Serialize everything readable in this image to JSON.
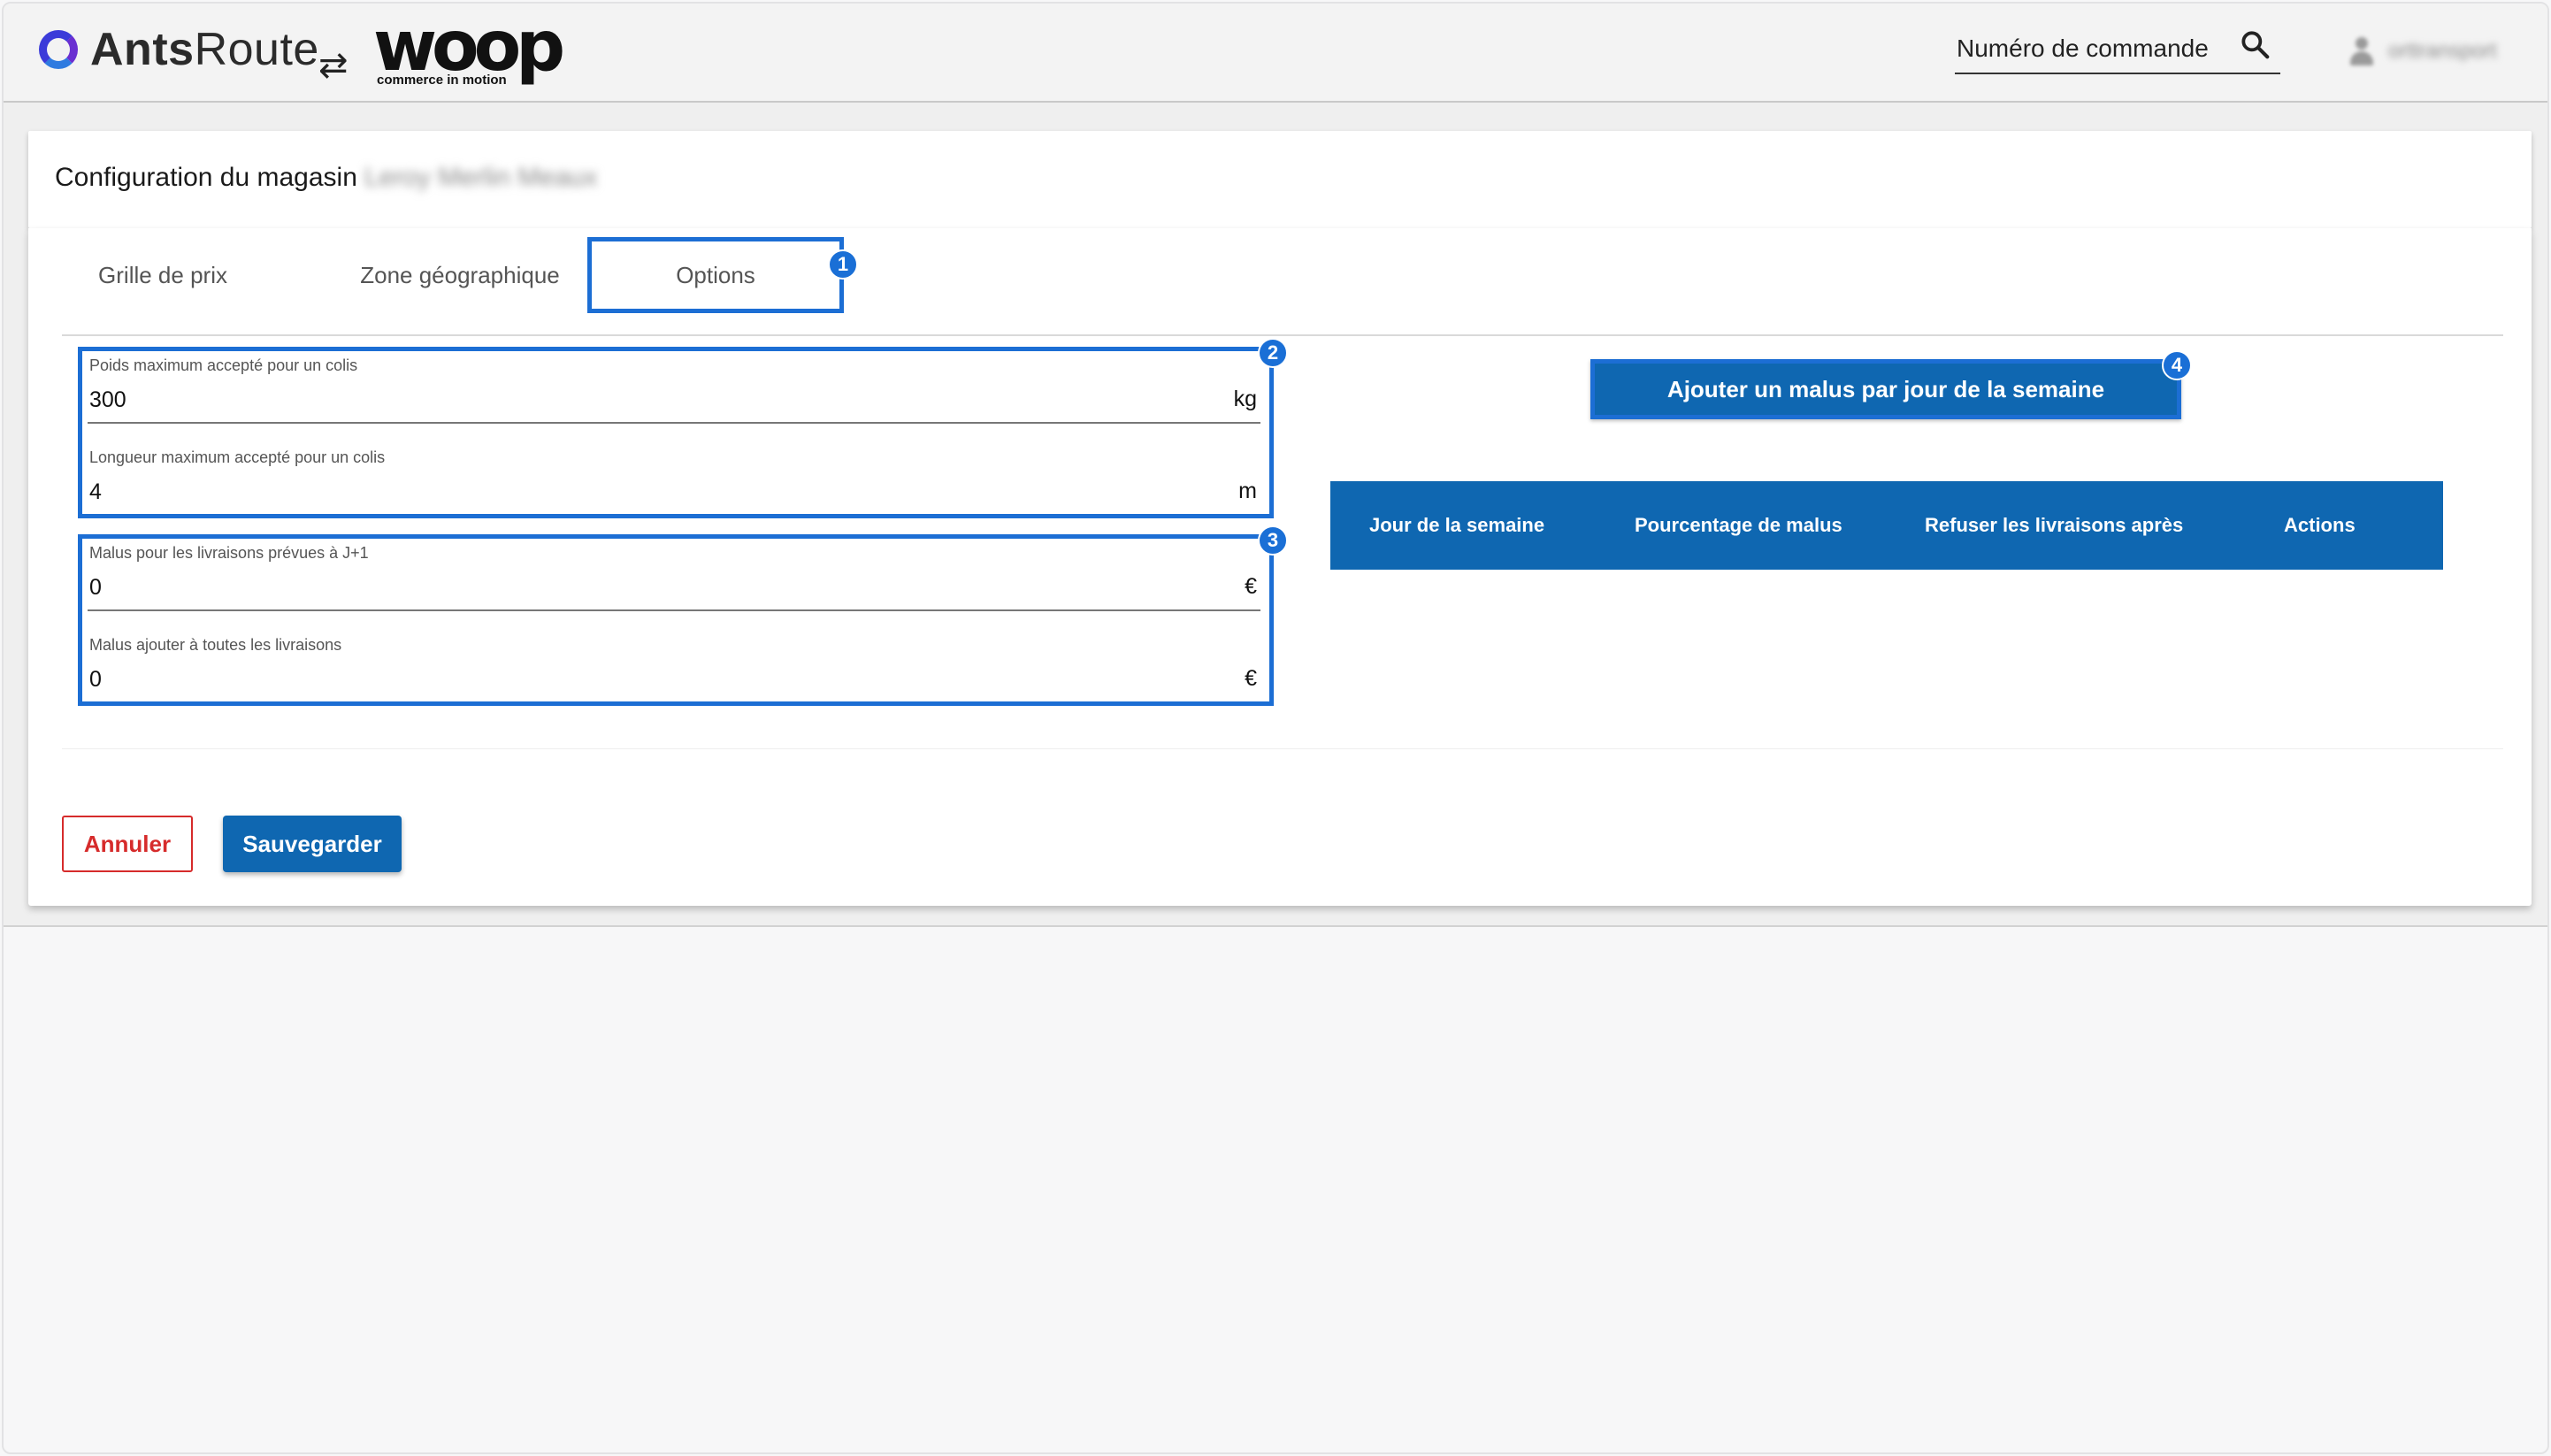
{
  "header": {
    "brand_ants": {
      "prefix": "Ants",
      "suffix": "Route"
    },
    "swap_symbol": "⇄",
    "brand_woop": {
      "word": "woop",
      "tagline": "commerce in motion"
    },
    "order_search": {
      "placeholder": "Numéro de commande",
      "value": ""
    },
    "search_icon": "search-icon",
    "user": {
      "name": "orttransport",
      "icon": "person-icon",
      "blurred": true
    }
  },
  "config": {
    "title": "Configuration du magasin",
    "store_name": "Leroy Merlin Meaux",
    "store_name_blurred": true
  },
  "tabs": [
    {
      "label": "Grille de prix",
      "active": false
    },
    {
      "label": "Zone géographique",
      "active": false
    },
    {
      "label": "Options",
      "active": true
    }
  ],
  "annotations": {
    "tab_options": "1",
    "group_weights": "2",
    "group_malus": "3",
    "add_malus_button": "4"
  },
  "fields": {
    "max_weight": {
      "label": "Poids maximum accepté pour un colis",
      "value": "300",
      "unit": "kg"
    },
    "max_length": {
      "label": "Longueur maximum accepté pour un colis",
      "value": "4",
      "unit": "m"
    },
    "malus_next_day": {
      "label": "Malus pour les livraisons prévues à J+1",
      "value": "0",
      "unit": "€"
    },
    "malus_all": {
      "label": "Malus ajouter à toutes les livraisons",
      "value": "0",
      "unit": "€"
    }
  },
  "add_malus_button": "Ajouter un malus par jour de la semaine",
  "malus_table": {
    "columns": [
      "Jour de la semaine",
      "Pourcentage de malus",
      "Refuser les livraisons après",
      "Actions"
    ],
    "rows": []
  },
  "actions": {
    "cancel": "Annuler",
    "save": "Sauvegarder"
  },
  "colors": {
    "primary": "#0f67b1",
    "highlight": "#1c6ed4",
    "cancel": "#d62b2b",
    "brand_ants": "#3b3bd9"
  }
}
